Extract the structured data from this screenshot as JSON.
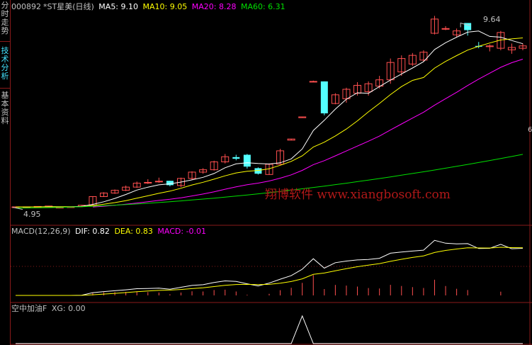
{
  "sidebar": {
    "tabs": [
      {
        "label": "分时走势",
        "active": false
      },
      {
        "label": "技术分析",
        "active": true
      },
      {
        "label": "基本资料",
        "active": false
      }
    ]
  },
  "main_panel": {
    "code": "000892",
    "name": "*ST星美(日线)",
    "indicators": [
      {
        "label": "MA5: 9.10",
        "color": "#ffffff"
      },
      {
        "label": "MA10: 9.05",
        "color": "#ffff00"
      },
      {
        "label": "MA20: 8.28",
        "color": "#ff00ff"
      },
      {
        "label": "MA60: 6.31",
        "color": "#00e000"
      }
    ],
    "high_label": "9.64",
    "low_label": "4.95",
    "right_label": "6"
  },
  "macd_panel": {
    "title": "MACD(12,26,9)",
    "dif": "DIF: 0.82",
    "dea": "DEA: 0.83",
    "macd": "MACD: -0.01"
  },
  "xg_panel": {
    "title": "空中加油F",
    "xg": "XG: 0.00"
  },
  "watermark": "翔博软件 www.xiangbosoft.com",
  "colors": {
    "up": "#ff4f4f",
    "down": "#54ffff",
    "grid": "#8a1a1a"
  },
  "chart_data": {
    "type": "candlestick",
    "candles": [
      [
        4.96,
        4.98,
        4.96,
        4.98
      ],
      [
        4.97,
        4.97,
        4.96,
        4.97
      ],
      [
        4.98,
        4.99,
        4.97,
        4.99
      ],
      [
        4.98,
        5.0,
        4.98,
        5.0
      ],
      [
        4.95,
        4.98,
        4.95,
        4.97
      ],
      [
        4.97,
        4.98,
        4.96,
        4.98
      ],
      [
        4.99,
        5.03,
        4.98,
        5.02
      ],
      [
        5.02,
        5.25,
        5.01,
        5.24
      ],
      [
        5.24,
        5.35,
        5.23,
        5.33
      ],
      [
        5.33,
        5.42,
        5.31,
        5.4
      ],
      [
        5.4,
        5.52,
        5.38,
        5.48
      ],
      [
        5.48,
        5.62,
        5.46,
        5.58
      ],
      [
        5.6,
        5.68,
        5.56,
        5.6
      ],
      [
        5.62,
        5.72,
        5.59,
        5.63
      ],
      [
        5.64,
        5.64,
        5.5,
        5.53
      ],
      [
        5.52,
        5.72,
        5.48,
        5.7
      ],
      [
        5.7,
        5.88,
        5.67,
        5.86
      ],
      [
        5.86,
        5.96,
        5.82,
        5.92
      ],
      [
        5.92,
        6.15,
        5.9,
        6.12
      ],
      [
        6.12,
        6.32,
        6.08,
        6.25
      ],
      [
        6.24,
        6.3,
        6.16,
        6.2
      ],
      [
        6.3,
        6.32,
        5.95,
        6.0
      ],
      [
        5.96,
        5.98,
        5.8,
        5.82
      ],
      [
        5.8,
        6.08,
        5.79,
        6.06
      ],
      [
        6.06,
        6.45,
        6.05,
        6.4
      ],
      [
        6.67,
        6.7,
        6.67,
        6.7
      ],
      [
        7.24,
        7.26,
        7.24,
        7.26
      ],
      [
        8.16,
        8.18,
        8.16,
        8.16
      ],
      [
        8.16,
        8.16,
        7.3,
        7.35
      ],
      [
        7.6,
        7.86,
        7.58,
        7.82
      ],
      [
        7.72,
        8.0,
        7.62,
        7.96
      ],
      [
        7.86,
        8.14,
        7.8,
        8.06
      ],
      [
        7.9,
        8.16,
        7.8,
        8.1
      ],
      [
        8.04,
        8.3,
        7.98,
        8.2
      ],
      [
        8.2,
        8.74,
        8.1,
        8.64
      ],
      [
        8.4,
        8.82,
        8.3,
        8.74
      ],
      [
        8.6,
        8.88,
        8.55,
        8.82
      ],
      [
        8.7,
        8.95,
        8.66,
        8.9
      ],
      [
        9.38,
        9.82,
        9.35,
        9.74
      ],
      [
        9.5,
        9.56,
        9.46,
        9.5
      ],
      [
        9.34,
        9.5,
        9.28,
        9.44
      ],
      [
        9.64,
        9.64,
        9.32,
        9.46
      ],
      [
        9.06,
        9.16,
        9.0,
        9.04
      ],
      [
        9.04,
        9.1,
        8.92,
        9.06
      ],
      [
        9.0,
        9.44,
        8.95,
        9.4
      ],
      [
        8.96,
        9.12,
        8.86,
        9.02
      ],
      [
        9.0,
        9.12,
        8.95,
        9.06
      ]
    ],
    "ma_values": {
      "MA5": 9.1,
      "MA10": 9.05,
      "MA20": 8.28,
      "MA60": 6.31
    },
    "price_high": 9.64,
    "price_low": 4.95,
    "macd": {
      "dif": 0.82,
      "dea": 0.83,
      "macd": -0.01
    },
    "xg": 0.0
  }
}
